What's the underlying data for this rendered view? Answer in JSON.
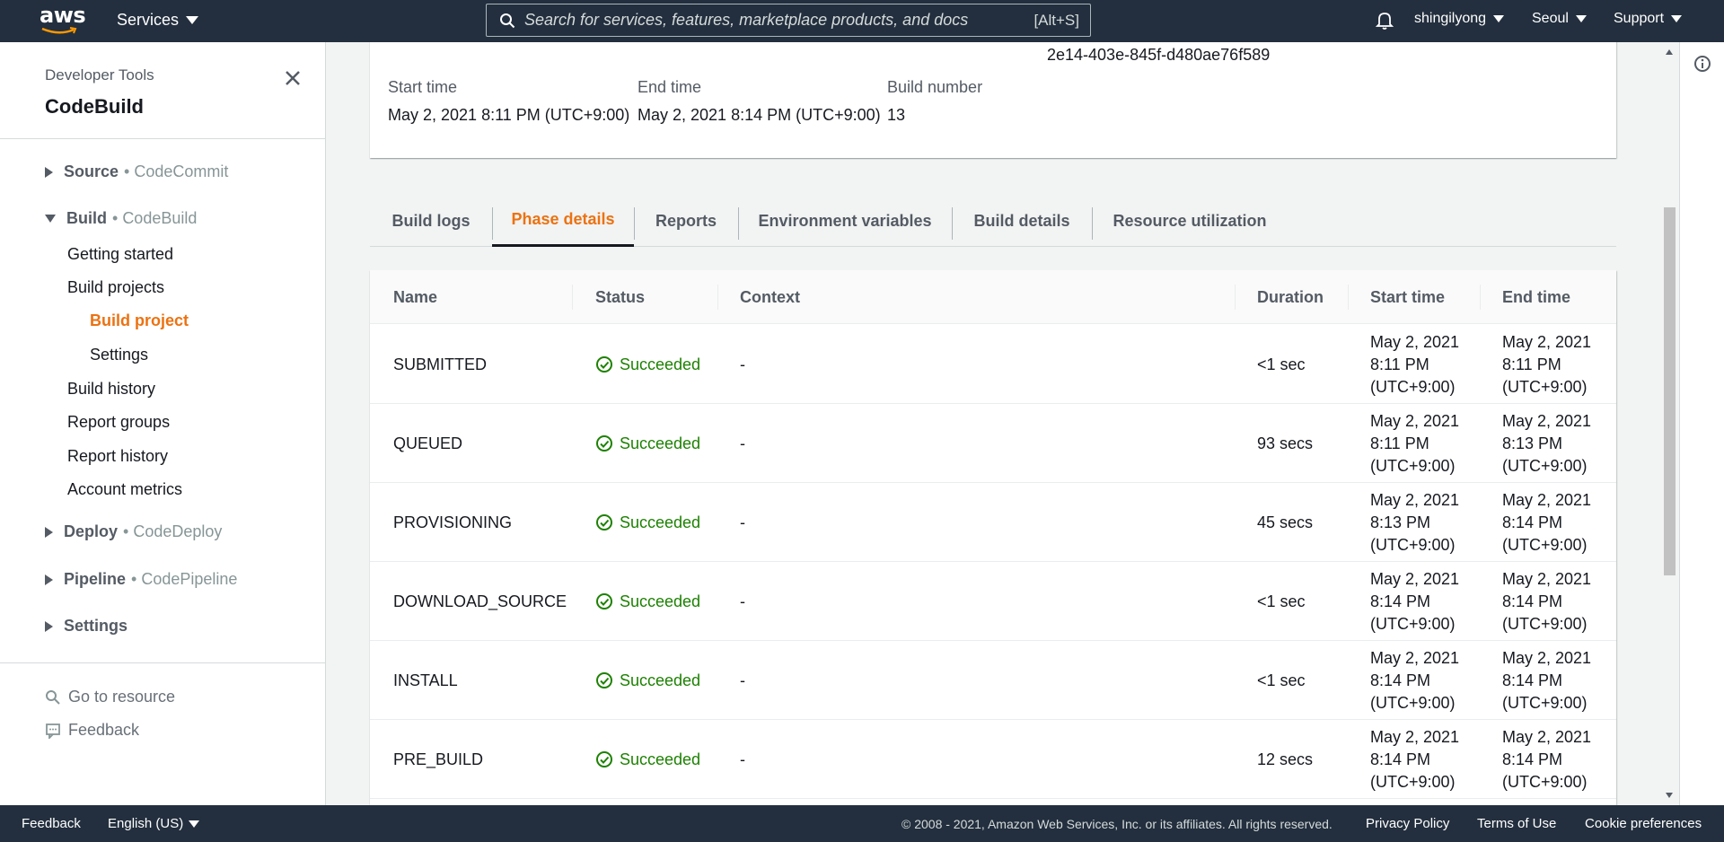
{
  "topnav": {
    "logo_text": "aws",
    "services_label": "Services",
    "search_placeholder": "Search for services, features, marketplace products, and docs",
    "search_shortcut": "[Alt+S]",
    "user": "shingilyong",
    "region": "Seoul",
    "support": "Support"
  },
  "sidebar": {
    "kicker": "Developer Tools",
    "title": "CodeBuild",
    "sections": [
      {
        "name": "Source",
        "sub": "CodeCommit",
        "expanded": false
      },
      {
        "name": "Build",
        "sub": "CodeBuild",
        "expanded": true
      },
      {
        "name": "Deploy",
        "sub": "CodeDeploy",
        "expanded": false
      },
      {
        "name": "Pipeline",
        "sub": "CodePipeline",
        "expanded": false
      },
      {
        "name": "Settings",
        "sub": "",
        "expanded": false
      }
    ],
    "build_links": [
      "Getting started",
      "Build projects",
      "Build project",
      "Settings",
      "Build history",
      "Report groups",
      "Report history",
      "Account metrics"
    ],
    "active_link": "Build project",
    "footer_links": [
      "Go to resource",
      "Feedback"
    ]
  },
  "summary": {
    "partial_id": "2e14-403e-845f-d480ae76f589",
    "start_time_label": "Start time",
    "start_time": "May 2, 2021 8:11 PM (UTC+9:00)",
    "end_time_label": "End time",
    "end_time": "May 2, 2021 8:14 PM (UTC+9:00)",
    "build_number_label": "Build number",
    "build_number": "13"
  },
  "tabs": [
    "Build logs",
    "Phase details",
    "Reports",
    "Environment variables",
    "Build details",
    "Resource utilization"
  ],
  "active_tab": "Phase details",
  "table": {
    "columns": [
      "Name",
      "Status",
      "Context",
      "Duration",
      "Start time",
      "End time"
    ],
    "rows": [
      {
        "name": "SUBMITTED",
        "status": "Succeeded",
        "context": "-",
        "duration": "<1 sec",
        "start": [
          "May 2, 2021",
          "8:11 PM",
          "(UTC+9:00)"
        ],
        "end": [
          "May 2, 2021",
          "8:11 PM",
          "(UTC+9:00)"
        ]
      },
      {
        "name": "QUEUED",
        "status": "Succeeded",
        "context": "-",
        "duration": "93 secs",
        "start": [
          "May 2, 2021",
          "8:11 PM",
          "(UTC+9:00)"
        ],
        "end": [
          "May 2, 2021",
          "8:13 PM",
          "(UTC+9:00)"
        ]
      },
      {
        "name": "PROVISIONING",
        "status": "Succeeded",
        "context": "-",
        "duration": "45 secs",
        "start": [
          "May 2, 2021",
          "8:13 PM",
          "(UTC+9:00)"
        ],
        "end": [
          "May 2, 2021",
          "8:14 PM",
          "(UTC+9:00)"
        ]
      },
      {
        "name": "DOWNLOAD_SOURCE",
        "status": "Succeeded",
        "context": "-",
        "duration": "<1 sec",
        "start": [
          "May 2, 2021",
          "8:14 PM",
          "(UTC+9:00)"
        ],
        "end": [
          "May 2, 2021",
          "8:14 PM",
          "(UTC+9:00)"
        ]
      },
      {
        "name": "INSTALL",
        "status": "Succeeded",
        "context": "-",
        "duration": "<1 sec",
        "start": [
          "May 2, 2021",
          "8:14 PM",
          "(UTC+9:00)"
        ],
        "end": [
          "May 2, 2021",
          "8:14 PM",
          "(UTC+9:00)"
        ]
      },
      {
        "name": "PRE_BUILD",
        "status": "Succeeded",
        "context": "-",
        "duration": "12 secs",
        "start": [
          "May 2, 2021",
          "8:14 PM",
          "(UTC+9:00)"
        ],
        "end": [
          "May 2, 2021",
          "8:14 PM",
          "(UTC+9:00)"
        ]
      }
    ]
  },
  "footer": {
    "feedback": "Feedback",
    "language": "English (US)",
    "copyright": "© 2008 - 2021, Amazon Web Services, Inc. or its affiliates. All rights reserved.",
    "privacy": "Privacy Policy",
    "terms": "Terms of Use",
    "cookies": "Cookie preferences"
  },
  "colors": {
    "nav_bg": "#232f3e",
    "accent": "#ec7211",
    "success": "#1d8102"
  }
}
